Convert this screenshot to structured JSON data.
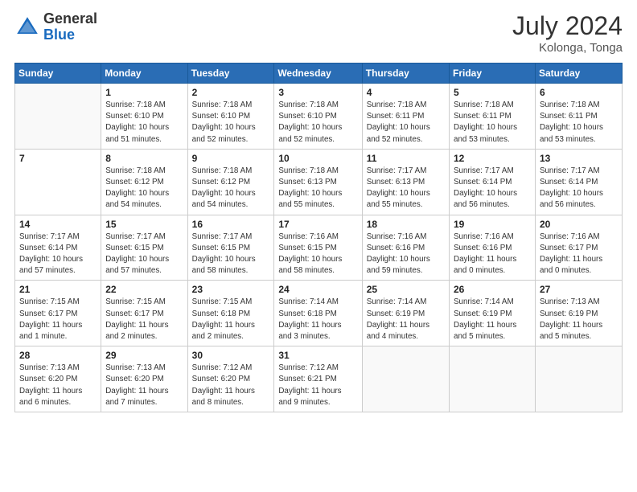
{
  "header": {
    "logo_general": "General",
    "logo_blue": "Blue",
    "month_year": "July 2024",
    "location": "Kolonga, Tonga"
  },
  "days_of_week": [
    "Sunday",
    "Monday",
    "Tuesday",
    "Wednesday",
    "Thursday",
    "Friday",
    "Saturday"
  ],
  "weeks": [
    [
      {
        "day": "",
        "info": ""
      },
      {
        "day": "1",
        "info": "Sunrise: 7:18 AM\nSunset: 6:10 PM\nDaylight: 10 hours\nand 51 minutes."
      },
      {
        "day": "2",
        "info": "Sunrise: 7:18 AM\nSunset: 6:10 PM\nDaylight: 10 hours\nand 52 minutes."
      },
      {
        "day": "3",
        "info": "Sunrise: 7:18 AM\nSunset: 6:10 PM\nDaylight: 10 hours\nand 52 minutes."
      },
      {
        "day": "4",
        "info": "Sunrise: 7:18 AM\nSunset: 6:11 PM\nDaylight: 10 hours\nand 52 minutes."
      },
      {
        "day": "5",
        "info": "Sunrise: 7:18 AM\nSunset: 6:11 PM\nDaylight: 10 hours\nand 53 minutes."
      },
      {
        "day": "6",
        "info": "Sunrise: 7:18 AM\nSunset: 6:11 PM\nDaylight: 10 hours\nand 53 minutes."
      }
    ],
    [
      {
        "day": "7",
        "info": ""
      },
      {
        "day": "8",
        "info": "Sunrise: 7:18 AM\nSunset: 6:12 PM\nDaylight: 10 hours\nand 54 minutes."
      },
      {
        "day": "9",
        "info": "Sunrise: 7:18 AM\nSunset: 6:12 PM\nDaylight: 10 hours\nand 54 minutes."
      },
      {
        "day": "10",
        "info": "Sunrise: 7:18 AM\nSunset: 6:13 PM\nDaylight: 10 hours\nand 55 minutes."
      },
      {
        "day": "11",
        "info": "Sunrise: 7:17 AM\nSunset: 6:13 PM\nDaylight: 10 hours\nand 55 minutes."
      },
      {
        "day": "12",
        "info": "Sunrise: 7:17 AM\nSunset: 6:14 PM\nDaylight: 10 hours\nand 56 minutes."
      },
      {
        "day": "13",
        "info": "Sunrise: 7:17 AM\nSunset: 6:14 PM\nDaylight: 10 hours\nand 56 minutes."
      }
    ],
    [
      {
        "day": "14",
        "info": "Sunrise: 7:17 AM\nSunset: 6:14 PM\nDaylight: 10 hours\nand 57 minutes."
      },
      {
        "day": "15",
        "info": "Sunrise: 7:17 AM\nSunset: 6:15 PM\nDaylight: 10 hours\nand 57 minutes."
      },
      {
        "day": "16",
        "info": "Sunrise: 7:17 AM\nSunset: 6:15 PM\nDaylight: 10 hours\nand 58 minutes."
      },
      {
        "day": "17",
        "info": "Sunrise: 7:16 AM\nSunset: 6:15 PM\nDaylight: 10 hours\nand 58 minutes."
      },
      {
        "day": "18",
        "info": "Sunrise: 7:16 AM\nSunset: 6:16 PM\nDaylight: 10 hours\nand 59 minutes."
      },
      {
        "day": "19",
        "info": "Sunrise: 7:16 AM\nSunset: 6:16 PM\nDaylight: 11 hours\nand 0 minutes."
      },
      {
        "day": "20",
        "info": "Sunrise: 7:16 AM\nSunset: 6:17 PM\nDaylight: 11 hours\nand 0 minutes."
      }
    ],
    [
      {
        "day": "21",
        "info": "Sunrise: 7:15 AM\nSunset: 6:17 PM\nDaylight: 11 hours\nand 1 minute."
      },
      {
        "day": "22",
        "info": "Sunrise: 7:15 AM\nSunset: 6:17 PM\nDaylight: 11 hours\nand 2 minutes."
      },
      {
        "day": "23",
        "info": "Sunrise: 7:15 AM\nSunset: 6:18 PM\nDaylight: 11 hours\nand 2 minutes."
      },
      {
        "day": "24",
        "info": "Sunrise: 7:14 AM\nSunset: 6:18 PM\nDaylight: 11 hours\nand 3 minutes."
      },
      {
        "day": "25",
        "info": "Sunrise: 7:14 AM\nSunset: 6:19 PM\nDaylight: 11 hours\nand 4 minutes."
      },
      {
        "day": "26",
        "info": "Sunrise: 7:14 AM\nSunset: 6:19 PM\nDaylight: 11 hours\nand 5 minutes."
      },
      {
        "day": "27",
        "info": "Sunrise: 7:13 AM\nSunset: 6:19 PM\nDaylight: 11 hours\nand 5 minutes."
      }
    ],
    [
      {
        "day": "28",
        "info": "Sunrise: 7:13 AM\nSunset: 6:20 PM\nDaylight: 11 hours\nand 6 minutes."
      },
      {
        "day": "29",
        "info": "Sunrise: 7:13 AM\nSunset: 6:20 PM\nDaylight: 11 hours\nand 7 minutes."
      },
      {
        "day": "30",
        "info": "Sunrise: 7:12 AM\nSunset: 6:20 PM\nDaylight: 11 hours\nand 8 minutes."
      },
      {
        "day": "31",
        "info": "Sunrise: 7:12 AM\nSunset: 6:21 PM\nDaylight: 11 hours\nand 9 minutes."
      },
      {
        "day": "",
        "info": ""
      },
      {
        "day": "",
        "info": ""
      },
      {
        "day": "",
        "info": ""
      }
    ]
  ]
}
